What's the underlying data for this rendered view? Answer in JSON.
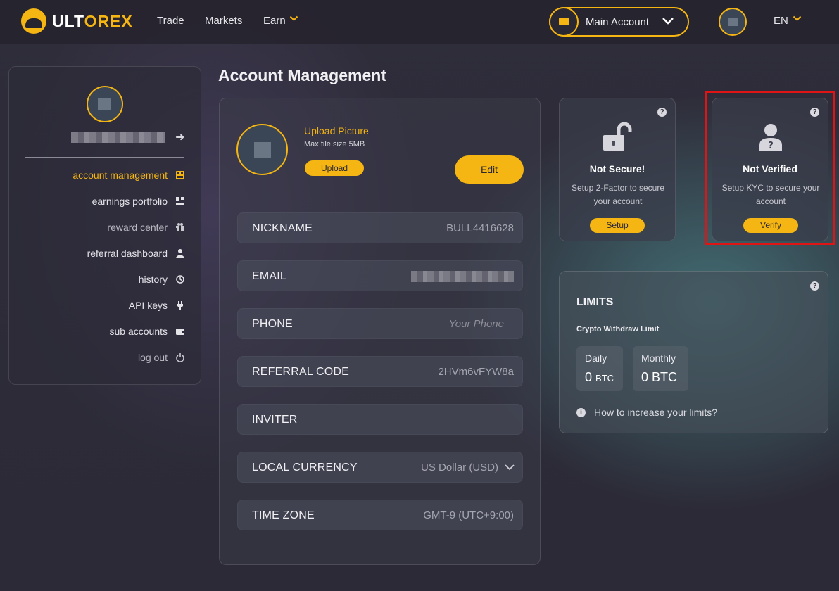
{
  "brand": {
    "name_white": "ULT",
    "name_yellow": "OREX",
    "accent": "#f5b512",
    "highlight": "#e01414"
  },
  "nav": {
    "trade": "Trade",
    "markets": "Markets",
    "earn": "Earn"
  },
  "account_selector": {
    "label": "Main Account",
    "icon": "wallet-icon"
  },
  "language": "EN",
  "page_title": "Account Management",
  "sidebar": {
    "items": [
      {
        "label": "account management",
        "icon": "dashboard-icon",
        "active": true
      },
      {
        "label": "earnings portfolio",
        "icon": "portfolio-icon"
      },
      {
        "label": "reward center",
        "icon": "gift-icon"
      },
      {
        "label": "referral dashboard",
        "icon": "users-icon"
      },
      {
        "label": "history",
        "icon": "history-icon"
      },
      {
        "label": "API keys",
        "icon": "plug-icon"
      },
      {
        "label": "sub accounts",
        "icon": "wallet-icon"
      },
      {
        "label": "log out",
        "icon": "power-icon"
      }
    ]
  },
  "profile": {
    "upload_title": "Upload Picture",
    "upload_note": "Max file size 5MB",
    "upload_button": "Upload",
    "edit_button": "Edit"
  },
  "fields": {
    "nickname": {
      "label": "NICKNAME",
      "value": "BULL4416628"
    },
    "email": {
      "label": "EMAIL"
    },
    "phone": {
      "label": "PHONE",
      "placeholder": "Your Phone"
    },
    "referral": {
      "label": "REFERRAL CODE",
      "value": "2HVm6vFYW8a"
    },
    "inviter": {
      "label": "INVITER",
      "value": ""
    },
    "currency": {
      "label": "LOCAL CURRENCY",
      "value": "US Dollar (USD)"
    },
    "timezone": {
      "label": "TIME ZONE",
      "value": "GMT-9 (UTC+9:00)"
    }
  },
  "security": {
    "twofa": {
      "title": "Not Secure!",
      "desc": "Setup 2-Factor to secure your account",
      "button": "Setup",
      "icon": "unlocked-padlock-icon"
    },
    "kyc": {
      "title": "Not Verified",
      "desc": "Setup KYC to secure your account",
      "button": "Verify",
      "icon": "user-question-icon"
    }
  },
  "limits": {
    "title": "LIMITS",
    "subtitle": "Crypto Withdraw Limit",
    "daily_label": "Daily",
    "daily_value": "0",
    "daily_unit": "BTC",
    "monthly_label": "Monthly",
    "monthly_value": "0 BTC",
    "link": "How to increase your limits?"
  }
}
